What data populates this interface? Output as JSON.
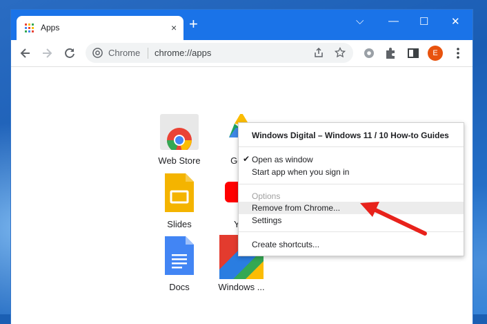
{
  "browser": {
    "tab": {
      "title": "Apps",
      "close_glyph": "×"
    },
    "new_tab_glyph": "+",
    "window_controls": {
      "dropdown": "⌵",
      "minimize": "—",
      "maximize": "☐",
      "close": "✕"
    },
    "omnibox": {
      "chip_label": "Chrome",
      "url": "chrome://apps"
    },
    "profile_initial": "E",
    "accent_color": "#1a73e8"
  },
  "apps": [
    {
      "label": "Web Store",
      "icon": "chrome-web-store-icon"
    },
    {
      "label": "Goog",
      "icon": "google-drive-icon"
    },
    {
      "label": "Slides",
      "icon": "google-slides-icon"
    },
    {
      "label": "You",
      "icon": "youtube-icon"
    },
    {
      "label": "Docs",
      "icon": "google-docs-icon"
    },
    {
      "label": "Windows ...",
      "icon": "windows-digital-icon"
    }
  ],
  "context_menu": {
    "header": "Windows Digital – Windows 11 / 10 How-to Guides",
    "items": [
      {
        "label": "Open as window",
        "checked": true,
        "enabled": true
      },
      {
        "label": "Start app when you sign in",
        "enabled": true
      },
      {
        "label": "Options",
        "enabled": false
      },
      {
        "label": "Remove from Chrome...",
        "enabled": true,
        "highlighted": true
      },
      {
        "label": "Settings",
        "enabled": true
      },
      {
        "label": "Create shortcuts...",
        "enabled": true
      }
    ],
    "check_glyph": "✔"
  },
  "annotation_arrow_color": "#e8221b"
}
